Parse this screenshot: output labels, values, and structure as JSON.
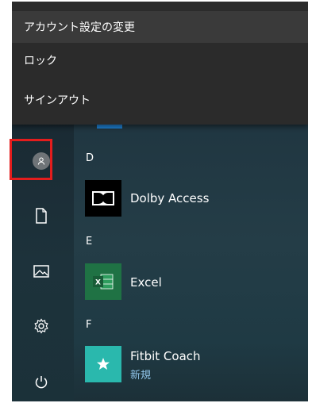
{
  "popup_menu": {
    "items": [
      {
        "label": "アカウント設定の変更"
      },
      {
        "label": "ロック"
      },
      {
        "label": "サインアウト"
      }
    ]
  },
  "app_list": {
    "groups": [
      {
        "letter": "D",
        "apps": [
          {
            "name": "Dolby Access",
            "icon": "dolby-icon"
          }
        ]
      },
      {
        "letter": "E",
        "apps": [
          {
            "name": "Excel",
            "icon": "excel-icon"
          }
        ]
      },
      {
        "letter": "F",
        "apps": [
          {
            "name": "Fitbit Coach",
            "subtitle": "新規",
            "icon": "fitbit-star-icon"
          }
        ]
      }
    ]
  },
  "rail": {
    "icons": [
      "user-avatar-icon",
      "document-icon",
      "pictures-icon",
      "settings-gear-icon",
      "power-icon"
    ]
  },
  "colors": {
    "highlight": "#e41d1d",
    "excel_green": "#1f7244",
    "fitbit_teal": "#2ab8ad",
    "new_label": "#8fc3e8"
  }
}
